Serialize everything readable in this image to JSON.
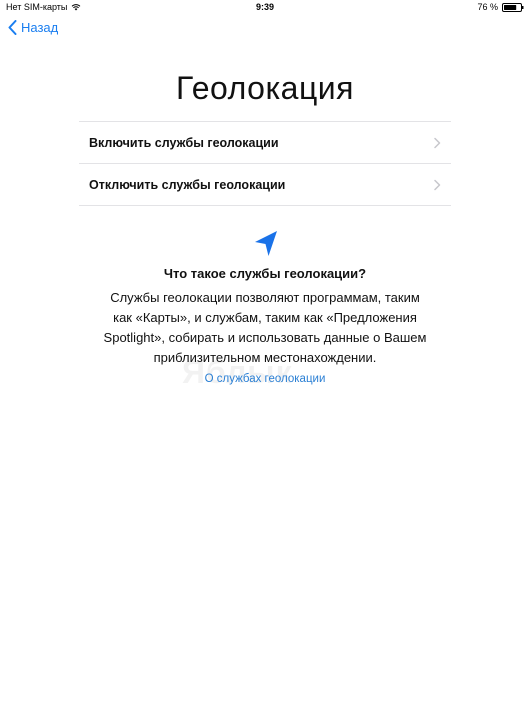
{
  "status_bar": {
    "carrier": "Нет SIM-карты",
    "time": "9:39",
    "battery_percent": "76 %",
    "battery_level": 0.76,
    "wifi_icon": "wifi-icon",
    "battery_icon": "battery-icon"
  },
  "nav": {
    "back_label": "Назад",
    "back_icon": "chevron-left-icon"
  },
  "title": "Геолокация",
  "options": [
    {
      "label": "Включить службы геолокации",
      "icon": "chevron-right-icon"
    },
    {
      "label": "Отключить службы геолокации",
      "icon": "chevron-right-icon"
    }
  ],
  "info": {
    "icon": "location-arrow-icon",
    "heading": "Что такое службы геолокации?",
    "body_lines": [
      "Службы геолокации позволяют программам, таким",
      "как «Карты», и службам, таким как «Предложения",
      "Spotlight», собирать и использовать данные о Вашем",
      "приблизительном местонахождении."
    ],
    "link": "О службах геолокации"
  },
  "watermark": "Яблык",
  "colors": {
    "accent": "#1a7ef0",
    "link": "#2a7fd4",
    "separator": "#e3e3e6",
    "location_arrow": "#1a72e8"
  }
}
